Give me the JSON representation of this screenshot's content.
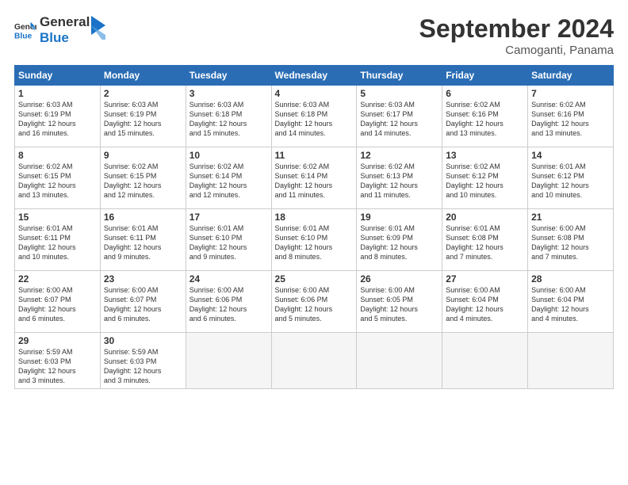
{
  "logo": {
    "line1": "General",
    "line2": "Blue"
  },
  "title": "September 2024",
  "subtitle": "Camoganti, Panama",
  "days_of_week": [
    "Sunday",
    "Monday",
    "Tuesday",
    "Wednesday",
    "Thursday",
    "Friday",
    "Saturday"
  ],
  "weeks": [
    [
      {
        "day": "1",
        "info": "Sunrise: 6:03 AM\nSunset: 6:19 PM\nDaylight: 12 hours\nand 16 minutes."
      },
      {
        "day": "2",
        "info": "Sunrise: 6:03 AM\nSunset: 6:19 PM\nDaylight: 12 hours\nand 15 minutes."
      },
      {
        "day": "3",
        "info": "Sunrise: 6:03 AM\nSunset: 6:18 PM\nDaylight: 12 hours\nand 15 minutes."
      },
      {
        "day": "4",
        "info": "Sunrise: 6:03 AM\nSunset: 6:18 PM\nDaylight: 12 hours\nand 14 minutes."
      },
      {
        "day": "5",
        "info": "Sunrise: 6:03 AM\nSunset: 6:17 PM\nDaylight: 12 hours\nand 14 minutes."
      },
      {
        "day": "6",
        "info": "Sunrise: 6:02 AM\nSunset: 6:16 PM\nDaylight: 12 hours\nand 13 minutes."
      },
      {
        "day": "7",
        "info": "Sunrise: 6:02 AM\nSunset: 6:16 PM\nDaylight: 12 hours\nand 13 minutes."
      }
    ],
    [
      {
        "day": "8",
        "info": "Sunrise: 6:02 AM\nSunset: 6:15 PM\nDaylight: 12 hours\nand 13 minutes."
      },
      {
        "day": "9",
        "info": "Sunrise: 6:02 AM\nSunset: 6:15 PM\nDaylight: 12 hours\nand 12 minutes."
      },
      {
        "day": "10",
        "info": "Sunrise: 6:02 AM\nSunset: 6:14 PM\nDaylight: 12 hours\nand 12 minutes."
      },
      {
        "day": "11",
        "info": "Sunrise: 6:02 AM\nSunset: 6:14 PM\nDaylight: 12 hours\nand 11 minutes."
      },
      {
        "day": "12",
        "info": "Sunrise: 6:02 AM\nSunset: 6:13 PM\nDaylight: 12 hours\nand 11 minutes."
      },
      {
        "day": "13",
        "info": "Sunrise: 6:02 AM\nSunset: 6:12 PM\nDaylight: 12 hours\nand 10 minutes."
      },
      {
        "day": "14",
        "info": "Sunrise: 6:01 AM\nSunset: 6:12 PM\nDaylight: 12 hours\nand 10 minutes."
      }
    ],
    [
      {
        "day": "15",
        "info": "Sunrise: 6:01 AM\nSunset: 6:11 PM\nDaylight: 12 hours\nand 10 minutes."
      },
      {
        "day": "16",
        "info": "Sunrise: 6:01 AM\nSunset: 6:11 PM\nDaylight: 12 hours\nand 9 minutes."
      },
      {
        "day": "17",
        "info": "Sunrise: 6:01 AM\nSunset: 6:10 PM\nDaylight: 12 hours\nand 9 minutes."
      },
      {
        "day": "18",
        "info": "Sunrise: 6:01 AM\nSunset: 6:10 PM\nDaylight: 12 hours\nand 8 minutes."
      },
      {
        "day": "19",
        "info": "Sunrise: 6:01 AM\nSunset: 6:09 PM\nDaylight: 12 hours\nand 8 minutes."
      },
      {
        "day": "20",
        "info": "Sunrise: 6:01 AM\nSunset: 6:08 PM\nDaylight: 12 hours\nand 7 minutes."
      },
      {
        "day": "21",
        "info": "Sunrise: 6:00 AM\nSunset: 6:08 PM\nDaylight: 12 hours\nand 7 minutes."
      }
    ],
    [
      {
        "day": "22",
        "info": "Sunrise: 6:00 AM\nSunset: 6:07 PM\nDaylight: 12 hours\nand 6 minutes."
      },
      {
        "day": "23",
        "info": "Sunrise: 6:00 AM\nSunset: 6:07 PM\nDaylight: 12 hours\nand 6 minutes."
      },
      {
        "day": "24",
        "info": "Sunrise: 6:00 AM\nSunset: 6:06 PM\nDaylight: 12 hours\nand 6 minutes."
      },
      {
        "day": "25",
        "info": "Sunrise: 6:00 AM\nSunset: 6:06 PM\nDaylight: 12 hours\nand 5 minutes."
      },
      {
        "day": "26",
        "info": "Sunrise: 6:00 AM\nSunset: 6:05 PM\nDaylight: 12 hours\nand 5 minutes."
      },
      {
        "day": "27",
        "info": "Sunrise: 6:00 AM\nSunset: 6:04 PM\nDaylight: 12 hours\nand 4 minutes."
      },
      {
        "day": "28",
        "info": "Sunrise: 6:00 AM\nSunset: 6:04 PM\nDaylight: 12 hours\nand 4 minutes."
      }
    ],
    [
      {
        "day": "29",
        "info": "Sunrise: 5:59 AM\nSunset: 6:03 PM\nDaylight: 12 hours\nand 3 minutes."
      },
      {
        "day": "30",
        "info": "Sunrise: 5:59 AM\nSunset: 6:03 PM\nDaylight: 12 hours\nand 3 minutes."
      },
      {
        "day": "",
        "info": ""
      },
      {
        "day": "",
        "info": ""
      },
      {
        "day": "",
        "info": ""
      },
      {
        "day": "",
        "info": ""
      },
      {
        "day": "",
        "info": ""
      }
    ]
  ]
}
